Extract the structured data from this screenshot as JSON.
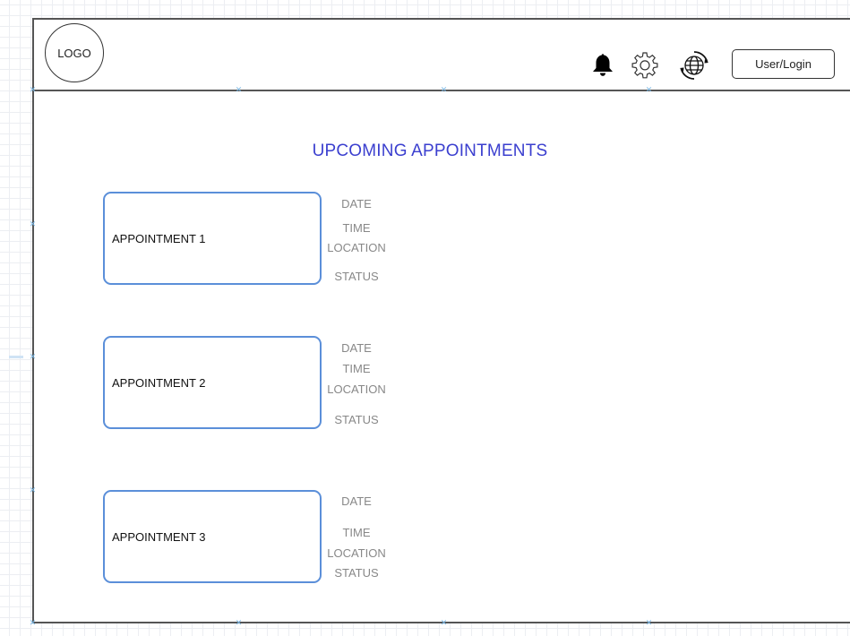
{
  "header": {
    "logo_label": "LOGO",
    "user_login_label": "User/Login",
    "icons": [
      "bell-icon",
      "gear-icon",
      "globe-icon"
    ]
  },
  "main": {
    "title": "UPCOMING APPOINTMENTS",
    "appointments": [
      {
        "label": "APPOINTMENT 1",
        "date": "DATE",
        "time": "TIME",
        "location": "LOCATION",
        "status": "STATUS"
      },
      {
        "label": "APPOINTMENT 2",
        "date": "DATE",
        "time": "TIME",
        "location": "LOCATION",
        "status": "STATUS"
      },
      {
        "label": "APPOINTMENT 3",
        "date": "DATE",
        "time": "TIME",
        "location": "LOCATION",
        "status": "STATUS"
      }
    ]
  },
  "colors": {
    "title": "#3b3fcf",
    "card_border": "#5b8fd9",
    "field_text": "#888888",
    "frame": "#555555"
  }
}
